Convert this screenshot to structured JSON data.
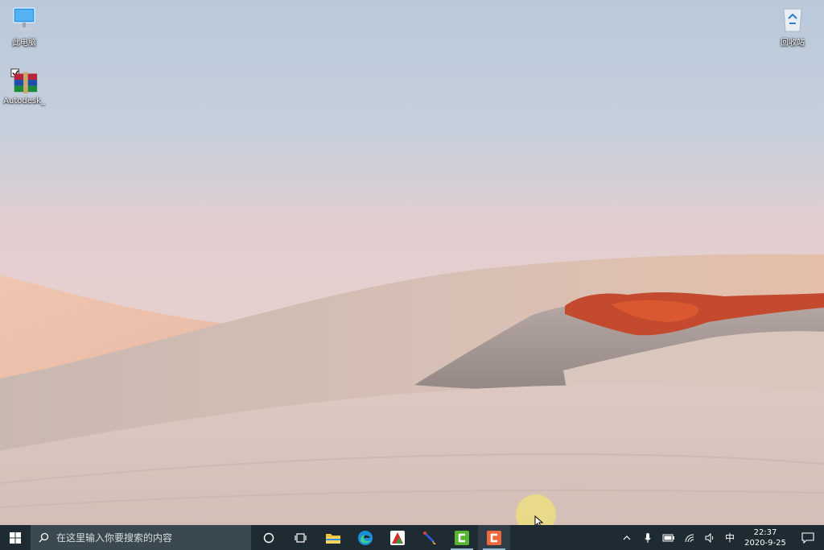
{
  "desktop": {
    "icons": [
      {
        "label": "此电脑",
        "icon": "computer-icon"
      },
      {
        "label": "Autodesk_",
        "icon": "winrar-archive-icon"
      },
      {
        "label": "回收站",
        "icon": "recycle-bin-icon"
      }
    ]
  },
  "taskbar": {
    "search_placeholder": "在这里输入你要搜索的内容",
    "apps": [
      {
        "name": "file-explorer",
        "icon": "folder-icon",
        "running": false
      },
      {
        "name": "edge",
        "icon": "edge-icon",
        "running": false
      },
      {
        "name": "app-red",
        "icon": "app-icon",
        "running": false
      },
      {
        "name": "app-brush",
        "icon": "paint-brush-icon",
        "running": false
      },
      {
        "name": "camtasia-green",
        "icon": "camtasia-green-icon",
        "running": true
      },
      {
        "name": "camtasia-orange",
        "icon": "camtasia-orange-icon",
        "running": true,
        "active": true
      }
    ],
    "tray": {
      "ime": "中",
      "time": "22:37",
      "date": "2020-9-25"
    }
  },
  "colors": {
    "taskbar": "#1f2b33",
    "search_box": "#3a4850",
    "accent": "#0078d7"
  }
}
